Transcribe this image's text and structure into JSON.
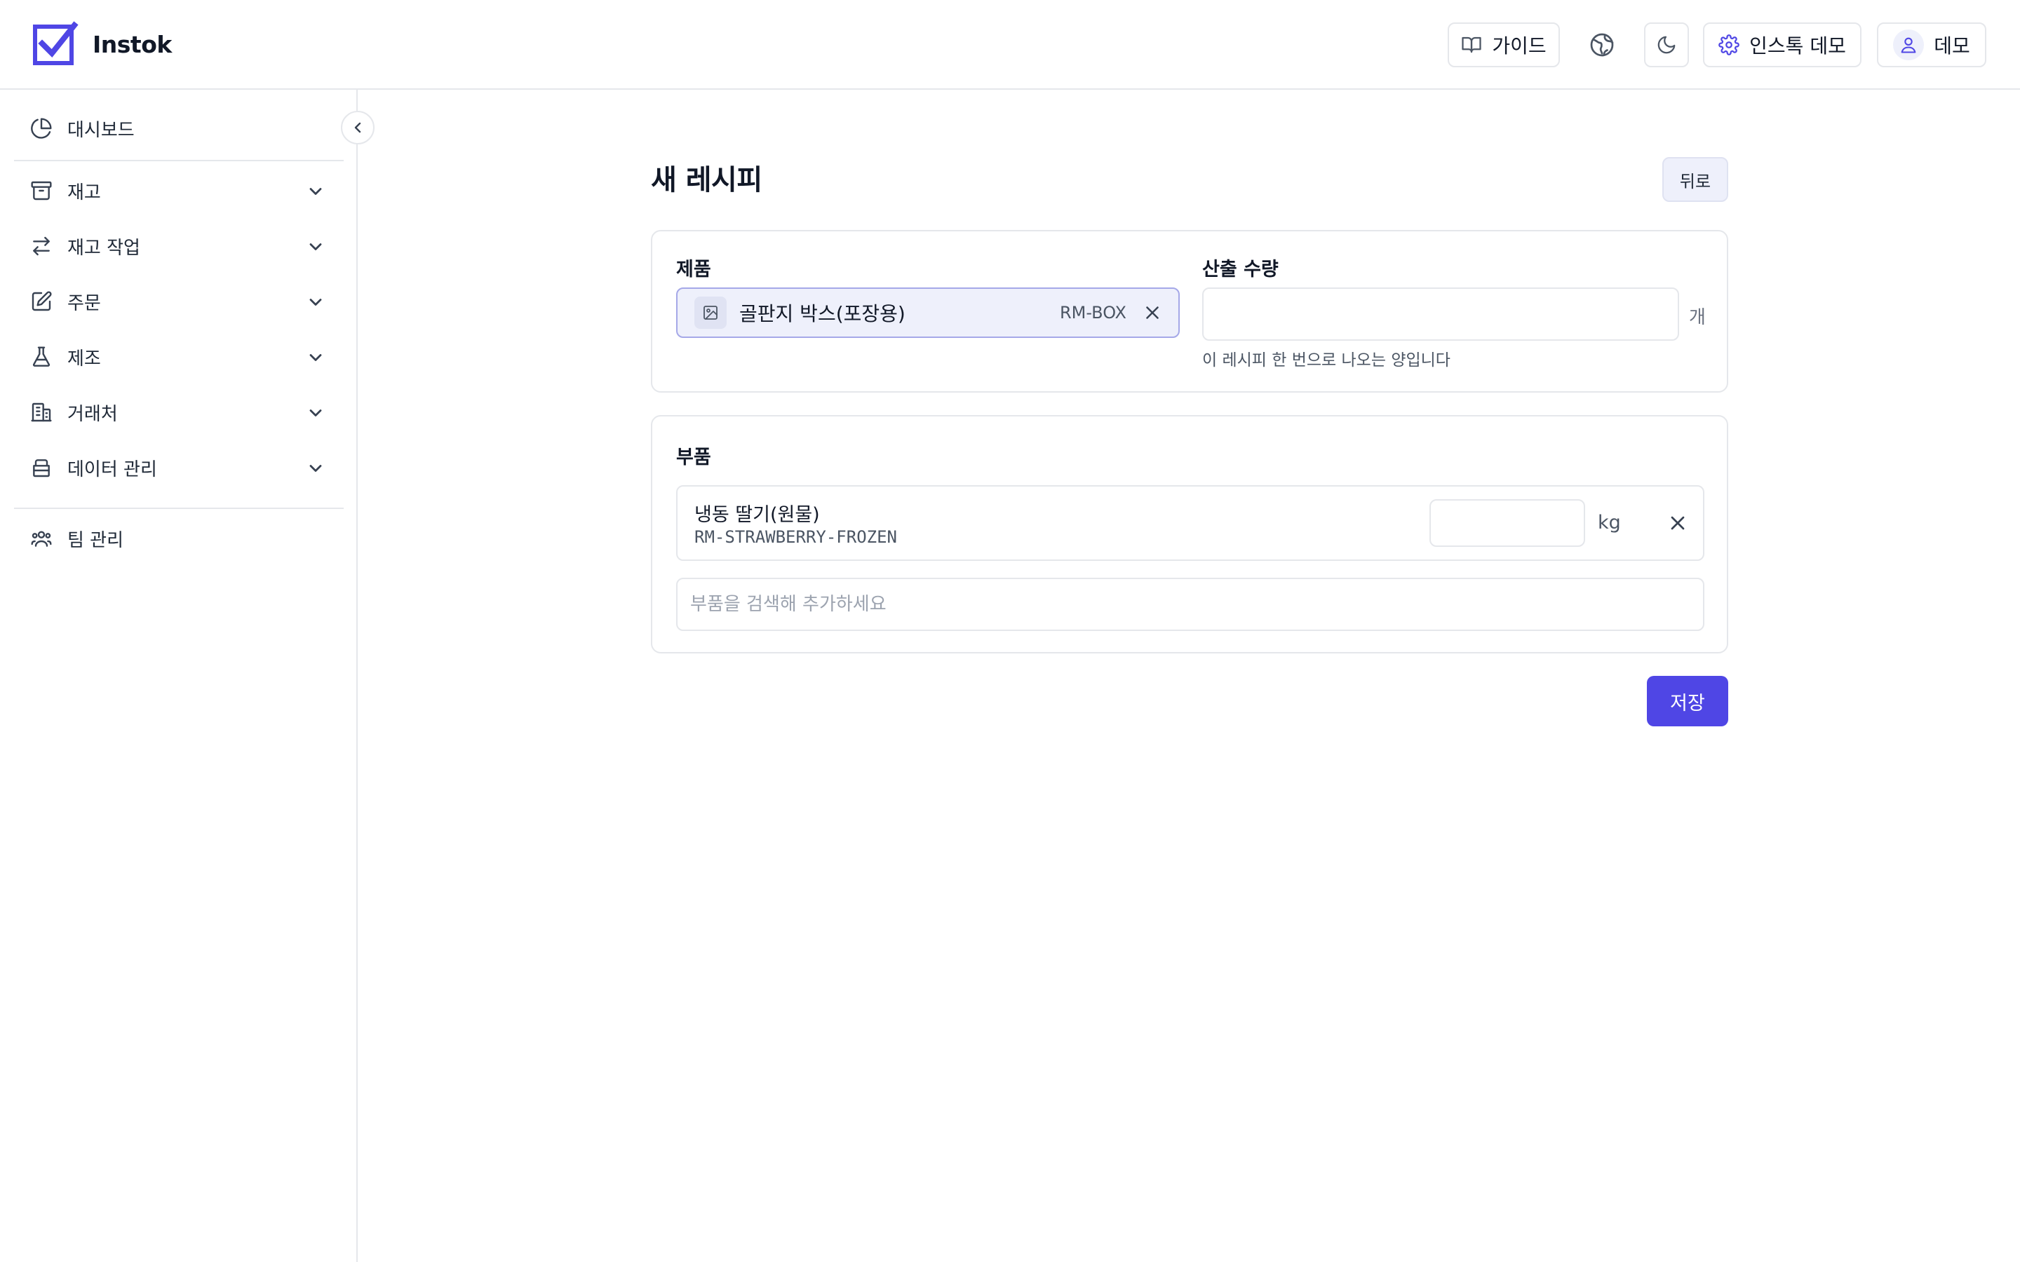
{
  "brand": {
    "name": "Instok",
    "accent": "#4f46e5"
  },
  "header": {
    "guide_label": "가이드",
    "settings_label": "인스톡 데모",
    "user_label": "데모",
    "icons": [
      "book-icon",
      "globe-icon",
      "moon-icon",
      "gear-icon",
      "user-icon"
    ]
  },
  "sidebar": {
    "items": [
      {
        "label": "대시보드",
        "icon": "pie-chart-icon"
      },
      {
        "label": "재고",
        "icon": "archive-icon"
      },
      {
        "label": "재고 작업",
        "icon": "arrows-icon"
      },
      {
        "label": "주문",
        "icon": "edit-icon"
      },
      {
        "label": "제조",
        "icon": "flask-icon"
      },
      {
        "label": "거래처",
        "icon": "building-icon"
      },
      {
        "label": "데이터 관리",
        "icon": "database-icon"
      },
      {
        "label": "팀 관리",
        "icon": "users-icon"
      }
    ]
  },
  "page": {
    "title": "새 레시피",
    "back_label": "뒤로",
    "save_label": "저장"
  },
  "product": {
    "label": "제품",
    "selected_name": "골판지 박스(포장용)",
    "selected_sku": "RM-BOX"
  },
  "output_qty": {
    "label": "산출 수량",
    "value": "",
    "unit": "개",
    "help": "이 레시피 한 번으로 나오는 양입니다"
  },
  "components": {
    "label": "부품",
    "items": [
      {
        "name": "냉동 딸기(원물)",
        "sku": "RM-STRAWBERRY-FROZEN",
        "qty": "",
        "unit": "kg"
      }
    ],
    "search_placeholder": "부품을 검색해 추가하세요"
  }
}
